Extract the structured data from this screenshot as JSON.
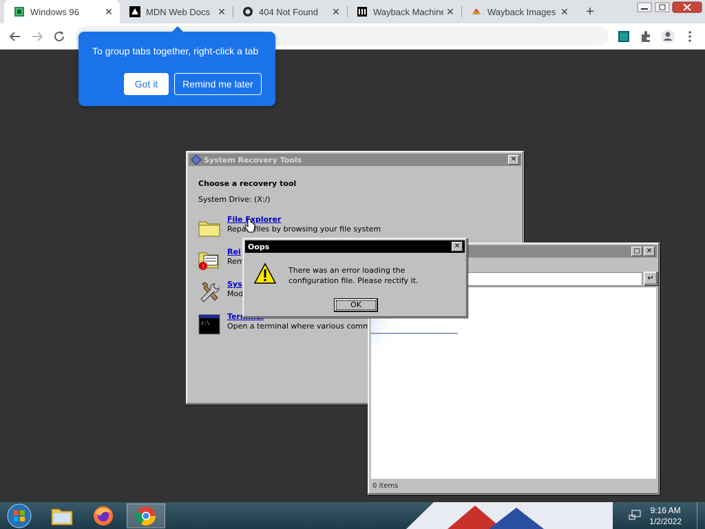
{
  "browser": {
    "tabs": [
      {
        "title": "Windows 96",
        "icon": "windows96-favicon",
        "active": true
      },
      {
        "title": "MDN Web Docs",
        "icon": "mdn-favicon",
        "active": false
      },
      {
        "title": "404 Not Found",
        "icon": "github-favicon",
        "active": false
      },
      {
        "title": "Wayback Machine",
        "icon": "archive-favicon",
        "active": false
      },
      {
        "title": "Wayback Images -",
        "icon": "google-favicon",
        "active": false
      }
    ],
    "new_tab_label": "+"
  },
  "tooltip": {
    "message": "To group tabs together, right-click a tab",
    "got_it": "Got it",
    "remind": "Remind me later"
  },
  "recovery": {
    "title": "System Recovery Tools",
    "heading": "Choose a recovery tool",
    "drive": "System Drive: (X:/)",
    "items": [
      {
        "link": "File Explorer",
        "desc": "Repair files by browsing your file system",
        "icon": "folder-icon"
      },
      {
        "link": "Rei",
        "desc": "Rem",
        "icon": "reinstall-icon"
      },
      {
        "link": "Sys",
        "desc": "Modi",
        "icon": "tools-icon"
      },
      {
        "link": "Terminal",
        "desc": "Open a terminal where various command",
        "icon": "terminal-icon"
      }
    ]
  },
  "oops": {
    "title": "Oops",
    "message": "There was an error loading the configuration file. Please rectify it.",
    "ok": "OK"
  },
  "explorer": {
    "status": "0 items",
    "go": "↵"
  },
  "taskbar": {
    "time": "9:16 AM",
    "date": "1/2/2022"
  },
  "colors": {
    "accent_blue": "#1a73e8",
    "desktop": "#333333",
    "win_gray": "#c0c0c0"
  }
}
